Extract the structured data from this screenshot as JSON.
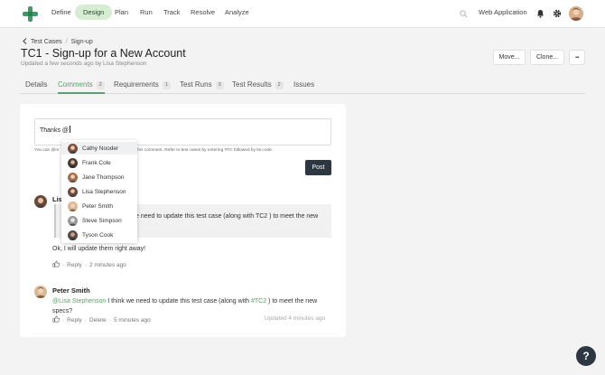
{
  "nav": {
    "items": [
      "Define",
      "Design",
      "Plan",
      "Run",
      "Track",
      "Resolve",
      "Analyze"
    ],
    "active_index": 1,
    "project": "Web Application"
  },
  "header": {
    "breadcrumb_parent": "Test Cases",
    "breadcrumb_sep": "/",
    "breadcrumb_current": "Sign-up",
    "title": "TC1 - Sign-up for a New Account",
    "subtitle": "Updated a few seconds ago by Lisa Stephenson",
    "move_label": "Move...",
    "clone_label": "Clone...",
    "more_label": "•••"
  },
  "tabs": [
    {
      "label": "Details",
      "count": ""
    },
    {
      "label": "Comments",
      "count": "2"
    },
    {
      "label": "Requirements",
      "count": "1"
    },
    {
      "label": "Test Runs",
      "count": "3"
    },
    {
      "label": "Test Results",
      "count": "2"
    },
    {
      "label": "Issues",
      "count": ""
    }
  ],
  "composer": {
    "value": "Thanks @",
    "hint_left": "You can @m",
    "hint_right": "this comment. Refer to test cases by entering #TC followed by its code.",
    "post_label": "Post"
  },
  "mention_list": [
    "Cathy Nooder",
    "Frank Cole",
    "Jane Thompson",
    "Lisa Stephenson",
    "Peter Smith",
    "Steve Simpson",
    "Tyson Cook"
  ],
  "comments": [
    {
      "author": "Lis",
      "quote_fragment": "e need to update this test case (along with TC2 ) to meet the new",
      "text": "Ok, I will update them right away!",
      "reply": "Reply",
      "sep": "·",
      "time": "2 minutes ago"
    },
    {
      "author": "Peter Smith",
      "mention": "@Lisa Stephenson",
      "text_a": " I think we need to update this test case (along with ",
      "tc_link": "#TC2",
      "text_b": " ) to meet the new",
      "text_c": "specs?",
      "reply": "Reply",
      "delete": "Delete",
      "sep": "·",
      "time": "5 minutes ago",
      "updated": "Updated 4 minutes ago"
    }
  ],
  "help_label": "?",
  "colors": {
    "accent": "#5aa26b",
    "dark": "#2d3742",
    "active_nav_bg": "#d6ecd3"
  }
}
